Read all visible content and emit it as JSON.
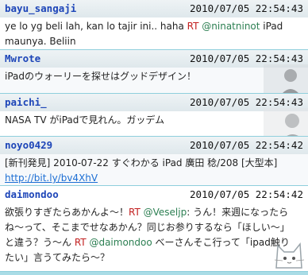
{
  "tweets": [
    {
      "user": "bayu_sangaji",
      "time": "2010/07/05 22:54:43",
      "line1_pre": "ye lo yg beli lah, kan lo tajir ini.. haha ",
      "line1_rt": "RT",
      "line1_mention": "@ninatninot",
      "line1_post": " iPad",
      "line2": "maunya. Beliin"
    },
    {
      "user": "Mwrote",
      "time": "2010/07/05 22:54:43",
      "line1": "iPadのウォーリーを探せはグッドデザイン！"
    },
    {
      "user": "paichi_",
      "time": "2010/07/05 22:54:43",
      "line1": "NASA TV がiPadで見れん。ガッデム"
    },
    {
      "user": "noyo0429",
      "time": "2010/07/05 22:54:42",
      "line1": "[新刊発見] 2010-07-22 すぐわかる iPad 廣田 稔/208 [大型本]",
      "link": "http://bit.ly/bv4XhV"
    },
    {
      "user": "daimondoo",
      "time": "2010/07/05 22:54:42",
      "line1_pre": "欲張りすぎたらあかんよ〜！",
      "line1_rt": "RT",
      "line1_mention": "@Veseljp",
      "line1_post": ": うん！来週になったら",
      "line2": "ね〜って、そこまでせなあかん？同じお参りするなら「ほしい〜」",
      "line3_pre": "と違う？う〜ん ",
      "line3_rt": "RT",
      "line3_mention": "@daimondoo",
      "line3_post": " べーさんそこ行って「ipad触り",
      "line4": "たい」言うてみたら〜？"
    }
  ]
}
